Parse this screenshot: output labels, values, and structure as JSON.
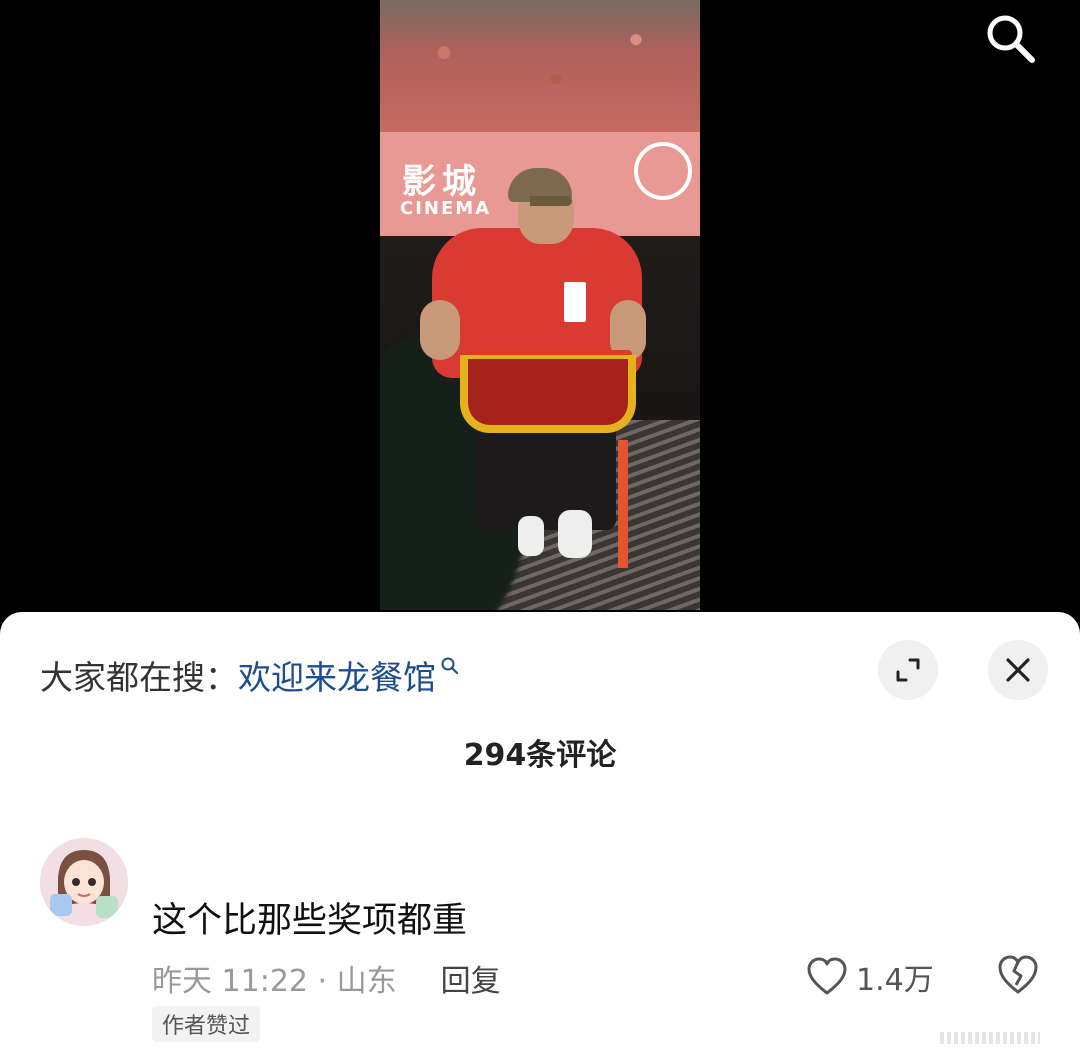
{
  "video": {
    "banner_text": "影城",
    "banner_subtext": "CINEMA"
  },
  "icons": {
    "search": "search-icon",
    "expand": "expand-icon",
    "close": "close-icon",
    "like": "heart-icon",
    "dislike": "broken-heart-icon"
  },
  "sheet": {
    "trending_label": "大家都在搜：",
    "trending_term": "欢迎来龙餐馆",
    "comment_count": "294条评论"
  },
  "comment": {
    "text": "这个比那些奖项都重",
    "time_location": "昨天 11:22 · 山东",
    "reply_label": "回复",
    "like_count": "1.4万",
    "author_badge": "作者赞过"
  },
  "colors": {
    "trend_link": "#1e4d8c",
    "sheet_bg": "#ffffff",
    "video_bg": "#000000"
  }
}
